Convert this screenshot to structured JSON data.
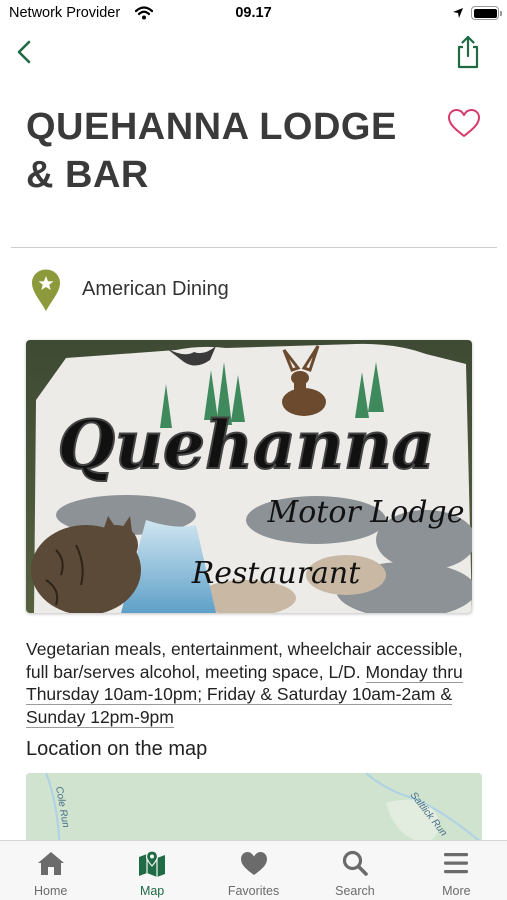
{
  "status_bar": {
    "carrier": "Network Provider",
    "time": "09.17"
  },
  "nav": {
    "back_icon": "chevron-left-icon",
    "share_icon": "share-icon"
  },
  "place": {
    "title_line1": "QUEHANNA LODGE",
    "title_line2": "& BAR",
    "category": "American Dining",
    "photo_text": {
      "sign_name": "Quehanna",
      "sign_subtitle": "Motor Lodge",
      "sign_bottom": "Restaurant"
    },
    "description_prefix": "Vegetarian meals, entertainment, wheelchair accessible, full bar/serves alcohol, meeting space, L/D.",
    "hours_text": "Monday thru Thursday 10am-10pm; Friday & Saturday 10am-2am & Sunday 12pm-9pm"
  },
  "map": {
    "heading": "Location on the map",
    "road_labels": [
      "Cole Run",
      "Saltlick Run"
    ]
  },
  "tabs": [
    {
      "label": "Home",
      "icon": "home-icon"
    },
    {
      "label": "Map",
      "icon": "map-icon"
    },
    {
      "label": "Favorites",
      "icon": "heart-icon"
    },
    {
      "label": "Search",
      "icon": "search-icon"
    },
    {
      "label": "More",
      "icon": "menu-icon"
    }
  ],
  "active_tab": "Map",
  "colors": {
    "accent_green": "#1e6b45",
    "pin_olive": "#8c9a3c",
    "favorite_pink": "#d63a6a",
    "tab_inactive": "#6b6b6b"
  }
}
